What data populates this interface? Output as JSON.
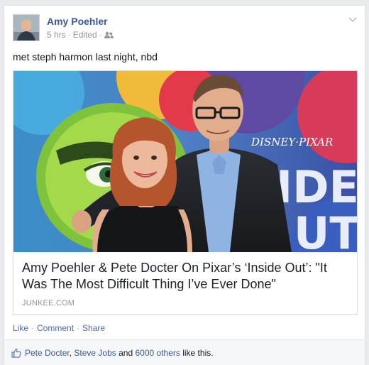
{
  "post": {
    "author": "Amy Poehler",
    "time": "5 hrs",
    "edited": "Edited",
    "separator": "·",
    "status_text": "met steph harmon last night, nbd",
    "icons": {
      "audience": "friends-audience-icon",
      "menu": "chevron-down-icon",
      "like": "thumbs-up-icon"
    }
  },
  "link": {
    "title": "Amy Poehler & Pete Docter On Pixar’s ‘Inside Out’: \"It Was The Most Difficult Thing I’ve Ever Done\"",
    "domain": "JUNKEE.COM",
    "image": {
      "brand_text": "DISNEY·PIXAR",
      "poster_text": "INSIDE OUT"
    }
  },
  "actions": {
    "like": "Like",
    "comment": "Comment",
    "share": "Share",
    "dot": "·"
  },
  "likes": {
    "person1": "Pete Docter",
    "comma": ",",
    "person2": "Steve Jobs",
    "and": "and",
    "others": "6000 others",
    "suffix": "like this."
  },
  "colors": {
    "link_blue": "#3b5998",
    "action_blue": "#4e69a2",
    "meta_gray": "#90949c",
    "background": "#e9ebee"
  }
}
